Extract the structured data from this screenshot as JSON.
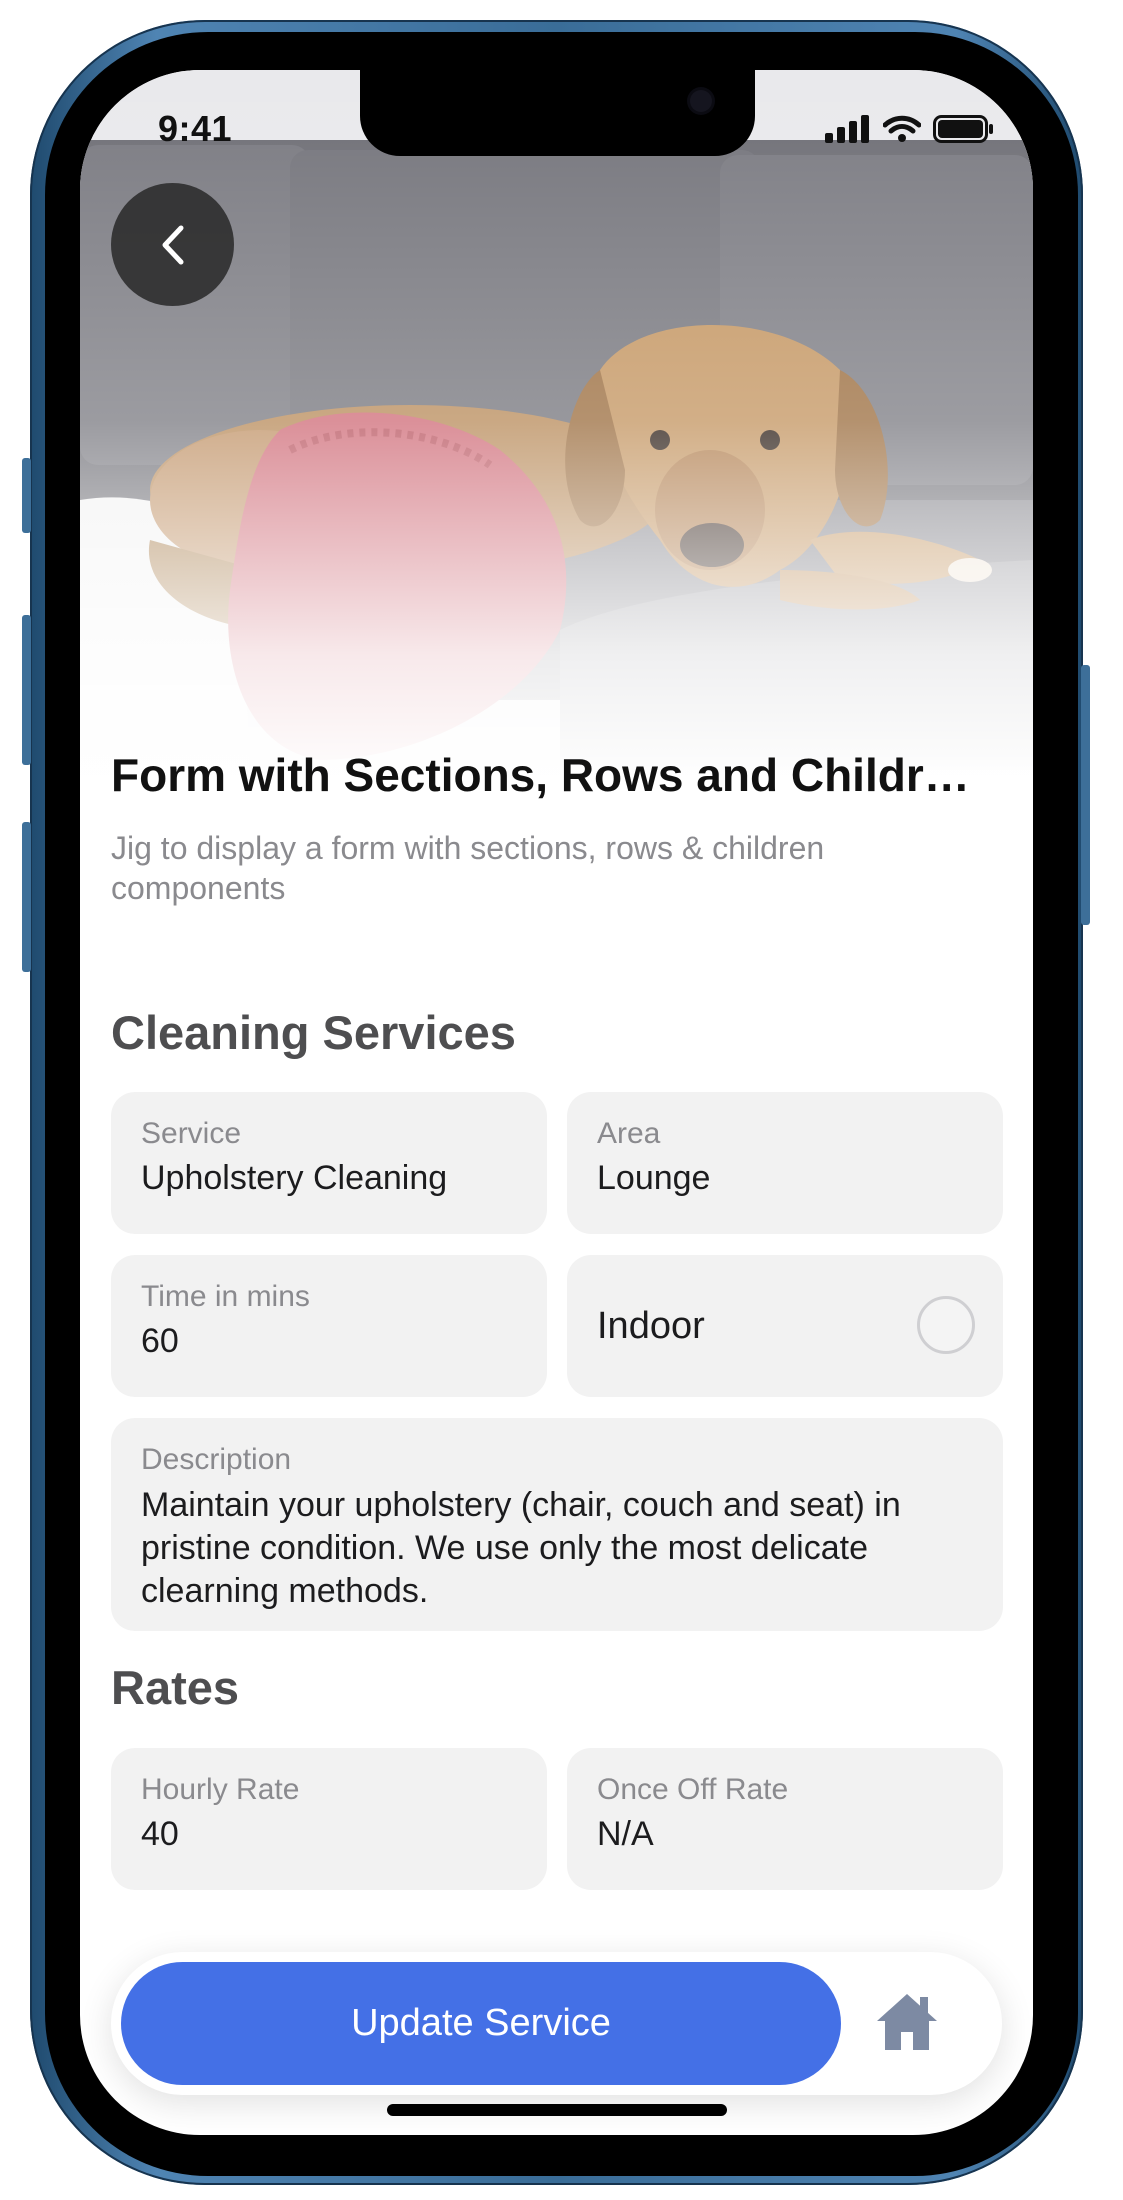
{
  "status_bar": {
    "time": "9:41"
  },
  "hero": {
    "image": "dog lying on grey sofa with pink pillow"
  },
  "header": {
    "title": "Form with Sections, Rows and Childr…",
    "subtitle": "Jig to display a form with sections, rows & children components"
  },
  "sections": [
    {
      "title": "Cleaning Services",
      "fields": {
        "service": {
          "label": "Service",
          "value": "Upholstery Cleaning"
        },
        "area": {
          "label": "Area",
          "value": "Lounge"
        },
        "time": {
          "label": "Time in mins",
          "value": "60"
        },
        "indoor": {
          "label": "Indoor",
          "checked": false
        },
        "description": {
          "label": "Description",
          "value": "Maintain your upholstery (chair, couch and seat) in pristine condition. We use only the most delicate clearning methods."
        }
      }
    },
    {
      "title": "Rates",
      "fields": {
        "hourly": {
          "label": "Hourly Rate",
          "value": "40"
        },
        "once_off": {
          "label": "Once Off Rate",
          "value": "N/A"
        }
      }
    }
  ],
  "actions": {
    "primary_label": "Update Service"
  },
  "icons": {
    "back": "chevron-left-icon",
    "home": "home-icon",
    "signal": "cellular-signal-icon",
    "wifi": "wifi-icon",
    "battery": "battery-icon"
  },
  "colors": {
    "accent": "#4470e6",
    "field_bg": "#f2f2f2",
    "home_icon": "#7d8aa3"
  }
}
